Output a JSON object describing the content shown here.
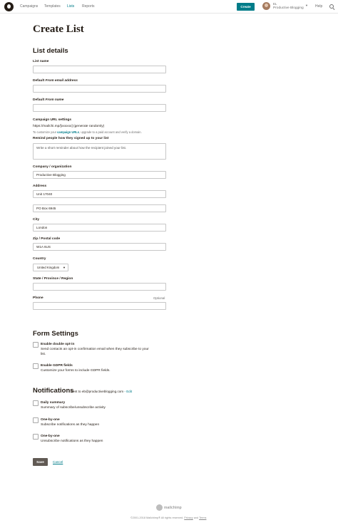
{
  "nav": {
    "links": [
      "Campaigns",
      "Templates",
      "Lists",
      "Reports"
    ],
    "active": "Lists",
    "create_label": "Create",
    "account_initials": "EL",
    "account_name": "Productive Blogging",
    "help_label": "Help"
  },
  "page_title": "Create List",
  "list_details": {
    "heading": "List details",
    "list_name_label": "List name",
    "list_name_value": "",
    "from_email_label_prefix": "Default ",
    "from_email_label_em": "From email address",
    "from_email_value": "",
    "from_name_label_prefix": "Default ",
    "from_name_label_em": "From name",
    "from_name_value": "",
    "url_settings_label": "Campaign URL settings",
    "url_value": "https://mailchi.mp/[xxxxxx] (generate randomly)",
    "url_helper_prefix": "To customize your ",
    "url_helper_link": "campaign URLs",
    "url_helper_suffix": ", upgrade to a paid account and verify a domain.",
    "remind_label": "Remind people how they signed up to your list",
    "remind_placeholder": "Write a short reminder about how the recipient joined your list.",
    "company_label": "Company / organization",
    "company_value": "Productive Blogging",
    "address_label": "Address",
    "address1_value": "Unit 17040",
    "address2_value": "PO Box 6945",
    "city_label": "City",
    "city_value": "London",
    "zip_label": "Zip / Postal code",
    "zip_value": "W1A 6US",
    "country_label": "Country",
    "country_value": "United Kingdom",
    "state_label": "State / Province / Region",
    "state_value": "",
    "phone_label": "Phone",
    "phone_optional": "Optional",
    "phone_value": ""
  },
  "form_settings": {
    "heading": "Form Settings",
    "double_optin_title": "Enable double opt-in",
    "double_optin_desc_1": "Send contacts an opt-in confirmation email when they subscribe to your",
    "double_optin_desc_2": "list.",
    "gdpr_title": "Enable GDPR fields",
    "gdpr_desc": "Customize your forms to include GDPR fields."
  },
  "notifications": {
    "heading": "Notifications",
    "sent_to": "Sent to eb@productiveblogging.com",
    "edit_label": " - Edit",
    "items": [
      {
        "title": "Daily summary",
        "desc": "Summary of subscribe/unsubscribe activity"
      },
      {
        "title": "One-by-one",
        "desc": "Subscribe notifications as they happen"
      },
      {
        "title": "One-by-one",
        "desc": "Unsubscribe notifications as they happen"
      }
    ]
  },
  "actions": {
    "save_label": "Save",
    "cancel_label": "Cancel"
  },
  "footer": {
    "brand": "mailchimp",
    "copyright": "©2001-2018 Mailchimp® All rights reserved. ",
    "privacy": "Privacy",
    "and": " and ",
    "terms": "Terms"
  }
}
